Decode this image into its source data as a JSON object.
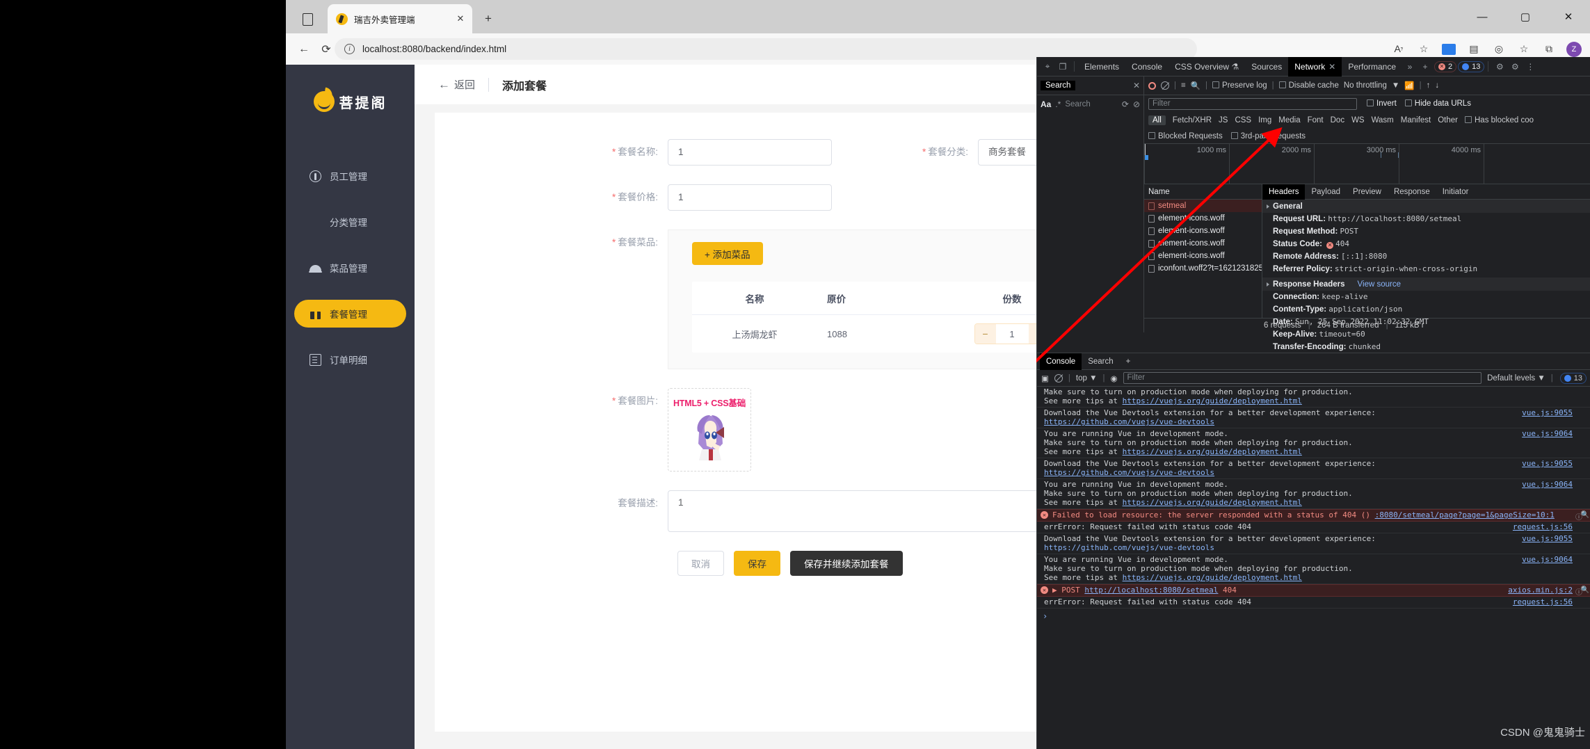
{
  "browser": {
    "tab_title": "瑞吉外卖管理端",
    "url": "localhost:8080/backend/index.html",
    "new_tab_label": "+",
    "close_tab_label": "✕",
    "window_minimize": "—",
    "window_maximize": "▢",
    "window_close": "✕",
    "back_label": "←",
    "reload_label": "⟳",
    "read_aloud_label": "A𝄾",
    "favorite_label": "☆",
    "collections_label": "▤",
    "profile_initial": "Z"
  },
  "sidebar": {
    "brand": "菩提阁",
    "items": [
      {
        "label": "员工管理",
        "icon": "staff-icon",
        "active": false
      },
      {
        "label": "分类管理",
        "icon": "grid-icon",
        "active": false
      },
      {
        "label": "菜品管理",
        "icon": "dish-cover-icon",
        "active": false
      },
      {
        "label": "套餐管理",
        "icon": "gift-icon",
        "active": true
      },
      {
        "label": "订单明细",
        "icon": "clipboard-icon",
        "active": false
      }
    ]
  },
  "page": {
    "back_label": "返回",
    "title": "添加套餐"
  },
  "form": {
    "name_label": "套餐名称:",
    "name_value": "1",
    "category_label": "套餐分类:",
    "category_value": "商务套餐",
    "price_label": "套餐价格:",
    "price_value": "1",
    "dishes_label": "套餐菜品:",
    "add_dish_button": "+ 添加菜品",
    "table_headers": [
      "名称",
      "原价",
      "份数"
    ],
    "table_rows": [
      {
        "name": "上汤焗龙虾",
        "price": "1088",
        "qty": "1"
      }
    ],
    "stepper_minus": "−",
    "stepper_plus": "+",
    "image_label": "套餐图片:",
    "image_caption": "HTML5 + CSS基础",
    "desc_label": "套餐描述:",
    "desc_value": "1"
  },
  "actions": {
    "cancel": "取消",
    "save": "保存",
    "save_continue": "保存并继续添加套餐"
  },
  "devtools": {
    "tabs": [
      {
        "label": "Elements",
        "selected": false
      },
      {
        "label": "Console",
        "selected": false
      },
      {
        "label": "CSS Overview",
        "selected": false
      },
      {
        "label": "Sources",
        "selected": false
      },
      {
        "label": "Network",
        "selected": true
      },
      {
        "label": "Performance",
        "selected": false
      }
    ],
    "more_label": "»",
    "add_label": "+",
    "error_count": "2",
    "info_count": "13",
    "settings_icon": "gear-icon",
    "customize_icon": "dots-icon",
    "search_panel": {
      "title": "Search",
      "close": "✕",
      "match_case": "Aa",
      "regex": ".*",
      "placeholder": "Search",
      "refresh": "⟳",
      "clear": "⊘"
    },
    "network": {
      "preserve_log": "Preserve log",
      "disable_cache": "Disable cache",
      "throttling": "No throttling",
      "throttling_caret": "▼",
      "filter_placeholder": "Filter",
      "invert": "Invert",
      "hide_data_urls": "Hide data URLs",
      "types": [
        "All",
        "Fetch/XHR",
        "JS",
        "CSS",
        "Img",
        "Media",
        "Font",
        "Doc",
        "WS",
        "Wasm",
        "Manifest",
        "Other"
      ],
      "has_blocked_cookies": "Has blocked coo",
      "blocked_requests": "Blocked Requests",
      "third_party": "3rd-party requests",
      "timeline_ticks": [
        "1000 ms",
        "2000 ms",
        "3000 ms",
        "4000 ms"
      ],
      "name_column": "Name",
      "requests": [
        {
          "name": "setmeal",
          "error": true
        },
        {
          "name": "element-icons.woff",
          "error": false
        },
        {
          "name": "element-icons.woff",
          "error": false
        },
        {
          "name": "element-icons.woff",
          "error": false
        },
        {
          "name": "element-icons.woff",
          "error": false
        },
        {
          "name": "iconfont.woff2?t=1621231825060",
          "error": false
        }
      ],
      "status_bar": {
        "requests": "6 requests",
        "transferred": "264 B transferred",
        "resources": "115 kB r"
      }
    },
    "detail": {
      "tabs": [
        {
          "label": "Headers",
          "selected": true
        },
        {
          "label": "Payload",
          "selected": false
        },
        {
          "label": "Preview",
          "selected": false
        },
        {
          "label": "Response",
          "selected": false
        },
        {
          "label": "Initiator",
          "selected": false
        }
      ],
      "general_title": "General",
      "general": [
        {
          "k": "Request URL:",
          "v": "http://localhost:8080/setmeal"
        },
        {
          "k": "Request Method:",
          "v": "POST"
        },
        {
          "k": "Status Code:",
          "v": "404",
          "status": true
        },
        {
          "k": "Remote Address:",
          "v": "[::1]:8080"
        },
        {
          "k": "Referrer Policy:",
          "v": "strict-origin-when-cross-origin"
        }
      ],
      "response_title": "Response Headers",
      "view_source": "View source",
      "response": [
        {
          "k": "Connection:",
          "v": "keep-alive"
        },
        {
          "k": "Content-Type:",
          "v": "application/json"
        },
        {
          "k": "Date:",
          "v": "Sun, 25 Sep 2022 11:02:32 GMT"
        },
        {
          "k": "Keep-Alive:",
          "v": "timeout=60"
        },
        {
          "k": "Transfer-Encoding:",
          "v": "chunked"
        }
      ]
    },
    "console": {
      "tabs": [
        {
          "label": "Console",
          "selected": true
        },
        {
          "label": "Search",
          "selected": false
        }
      ],
      "add_label": "+",
      "context": "top",
      "context_caret": "▼",
      "filter_placeholder": "Filter",
      "levels": "Default levels",
      "levels_caret": "▼",
      "info_count": "13",
      "prompt": "›",
      "watermark": "CSDN @鬼鬼骑士",
      "messages": [
        {
          "type": "log",
          "lines": [
            "Make sure to turn on production mode when deploying for production.",
            "See more tips at https://vuejs.org/guide/deployment.html"
          ],
          "link_line": 1,
          "link": "https://vuejs.org/guide/deployment.html",
          "source": ""
        },
        {
          "type": "log",
          "lines": [
            "Download the Vue Devtools extension for a better development experience:",
            "https://github.com/vuejs/vue-devtools"
          ],
          "link_line": 1,
          "link": "https://github.com/vuejs/vue-devtools",
          "source": "vue.js:9055"
        },
        {
          "type": "log",
          "lines": [
            "You are running Vue in development mode.",
            "Make sure to turn on production mode when deploying for production.",
            "See more tips at https://vuejs.org/guide/deployment.html"
          ],
          "link_line": 2,
          "link": "https://vuejs.org/guide/deployment.html",
          "source": "vue.js:9064"
        },
        {
          "type": "log",
          "lines": [
            "Download the Vue Devtools extension for a better development experience:",
            "https://github.com/vuejs/vue-devtools"
          ],
          "link_line": 1,
          "link": "https://github.com/vuejs/vue-devtools",
          "source": "vue.js:9055"
        },
        {
          "type": "log",
          "lines": [
            "You are running Vue in development mode.",
            "Make sure to turn on production mode when deploying for production.",
            "See more tips at https://vuejs.org/guide/deployment.html"
          ],
          "link_line": 2,
          "link": "https://vuejs.org/guide/deployment.html",
          "source": "vue.js:9064"
        },
        {
          "type": "error",
          "text": "Failed to load resource: the server responded with a status of 404 ()",
          "link": ":8080/setmeal/page?page=1&pageSize=10:1",
          "source": ""
        },
        {
          "type": "sub",
          "text": "errError: Request failed with status code 404",
          "source": "request.js:56"
        },
        {
          "type": "log",
          "lines": [
            "Download the Vue Devtools extension for a better development experience:",
            "https://github.com/vuejs/vue-devtools"
          ],
          "link_line": 1,
          "link": "https://github.com/vuejs/vue-devtools",
          "source": "vue.js:9055"
        },
        {
          "type": "log",
          "lines": [
            "You are running Vue in development mode.",
            "Make sure to turn on production mode when deploying for production.",
            "See more tips at https://vuejs.org/guide/deployment.html"
          ],
          "link_line": 2,
          "link": "https://vuejs.org/guide/deployment.html",
          "source": "vue.js:9064"
        },
        {
          "type": "error",
          "prefix": "▶ POST ",
          "text": "http://localhost:8080/setmeal",
          "suffix": " 404",
          "source": "axios.min.js:2"
        },
        {
          "type": "sub",
          "text": "errError: Request failed with status code 404",
          "source": "request.js:56"
        }
      ]
    }
  },
  "colors": {
    "brand_yellow": "#f5b912",
    "sidebar_dark": "#343744",
    "error_red": "#f28b82",
    "annotation_arrow": "#ff0000"
  }
}
